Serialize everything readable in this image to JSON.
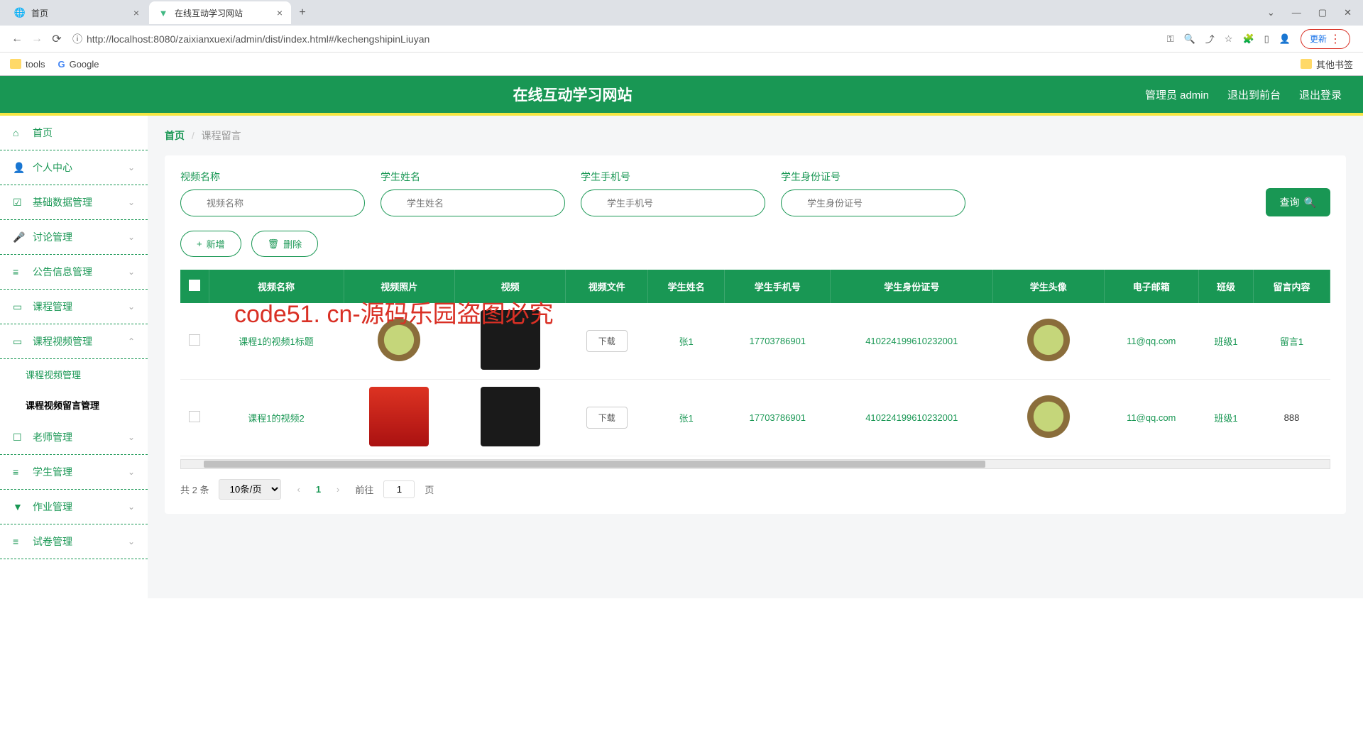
{
  "browser": {
    "tabs": [
      {
        "title": "首页",
        "active": false
      },
      {
        "title": "在线互动学习网站",
        "active": true
      }
    ],
    "url": "http://localhost:8080/zaixianxuexi/admin/dist/index.html#/kechengshipinLiuyan",
    "update_label": "更新",
    "bookmarks": {
      "tools": "tools",
      "google": "Google",
      "other": "其他书签"
    }
  },
  "header": {
    "title": "在线互动学习网站",
    "admin": "管理员 admin",
    "logout_front": "退出到前台",
    "logout": "退出登录"
  },
  "sidebar": {
    "items": [
      {
        "icon": "⌂",
        "label": "首页"
      },
      {
        "icon": "👤",
        "label": "个人中心",
        "arrow": true
      },
      {
        "icon": "☑",
        "label": "基础数据管理",
        "arrow": true
      },
      {
        "icon": "🎤",
        "label": "讨论管理",
        "arrow": true
      },
      {
        "icon": "≡",
        "label": "公告信息管理",
        "arrow": true
      },
      {
        "icon": "▭",
        "label": "课程管理",
        "arrow": true
      },
      {
        "icon": "▭",
        "label": "课程视频管理",
        "arrow": true,
        "open": true,
        "children": [
          {
            "label": "课程视频管理"
          },
          {
            "label": "课程视频留言管理",
            "active": true
          }
        ]
      },
      {
        "icon": "☐",
        "label": "老师管理",
        "arrow": true
      },
      {
        "icon": "≡",
        "label": "学生管理",
        "arrow": true
      },
      {
        "icon": "▼",
        "label": "作业管理",
        "arrow": true
      },
      {
        "icon": "≡",
        "label": "试卷管理",
        "arrow": true
      }
    ]
  },
  "breadcrumb": {
    "home": "首页",
    "current": "课程留言"
  },
  "filters": {
    "video_name": {
      "label": "视频名称",
      "placeholder": "视频名称"
    },
    "student_name": {
      "label": "学生姓名",
      "placeholder": "学生姓名"
    },
    "student_phone": {
      "label": "学生手机号",
      "placeholder": "学生手机号"
    },
    "student_id": {
      "label": "学生身份证号",
      "placeholder": "学生身份证号"
    },
    "query_btn": "查询"
  },
  "actions": {
    "add": "新增",
    "delete": "删除"
  },
  "table": {
    "headers": [
      "",
      "视频名称",
      "视频照片",
      "视频",
      "视频文件",
      "学生姓名",
      "学生手机号",
      "学生身份证号",
      "学生头像",
      "电子邮箱",
      "班级",
      "留言内容"
    ],
    "rows": [
      {
        "name": "课程1的视频1标题",
        "download": "下载",
        "student": "张1",
        "phone": "17703786901",
        "idcard": "410224199610232001",
        "email": "11@qq.com",
        "class": "班级1",
        "msg": "留言1"
      },
      {
        "name": "课程1的视频2",
        "download": "下载",
        "student": "张1",
        "phone": "17703786901",
        "idcard": "410224199610232001",
        "email": "11@qq.com",
        "class": "班级1",
        "msg": "888"
      }
    ]
  },
  "pagination": {
    "total": "共 2 条",
    "page_size": "10条/页",
    "current": "1",
    "goto_label": "前往",
    "goto_value": "1",
    "page_suffix": "页"
  },
  "watermarks": {
    "text": "code51.cn",
    "red": "code51. cn-源码乐园盗图必究"
  }
}
